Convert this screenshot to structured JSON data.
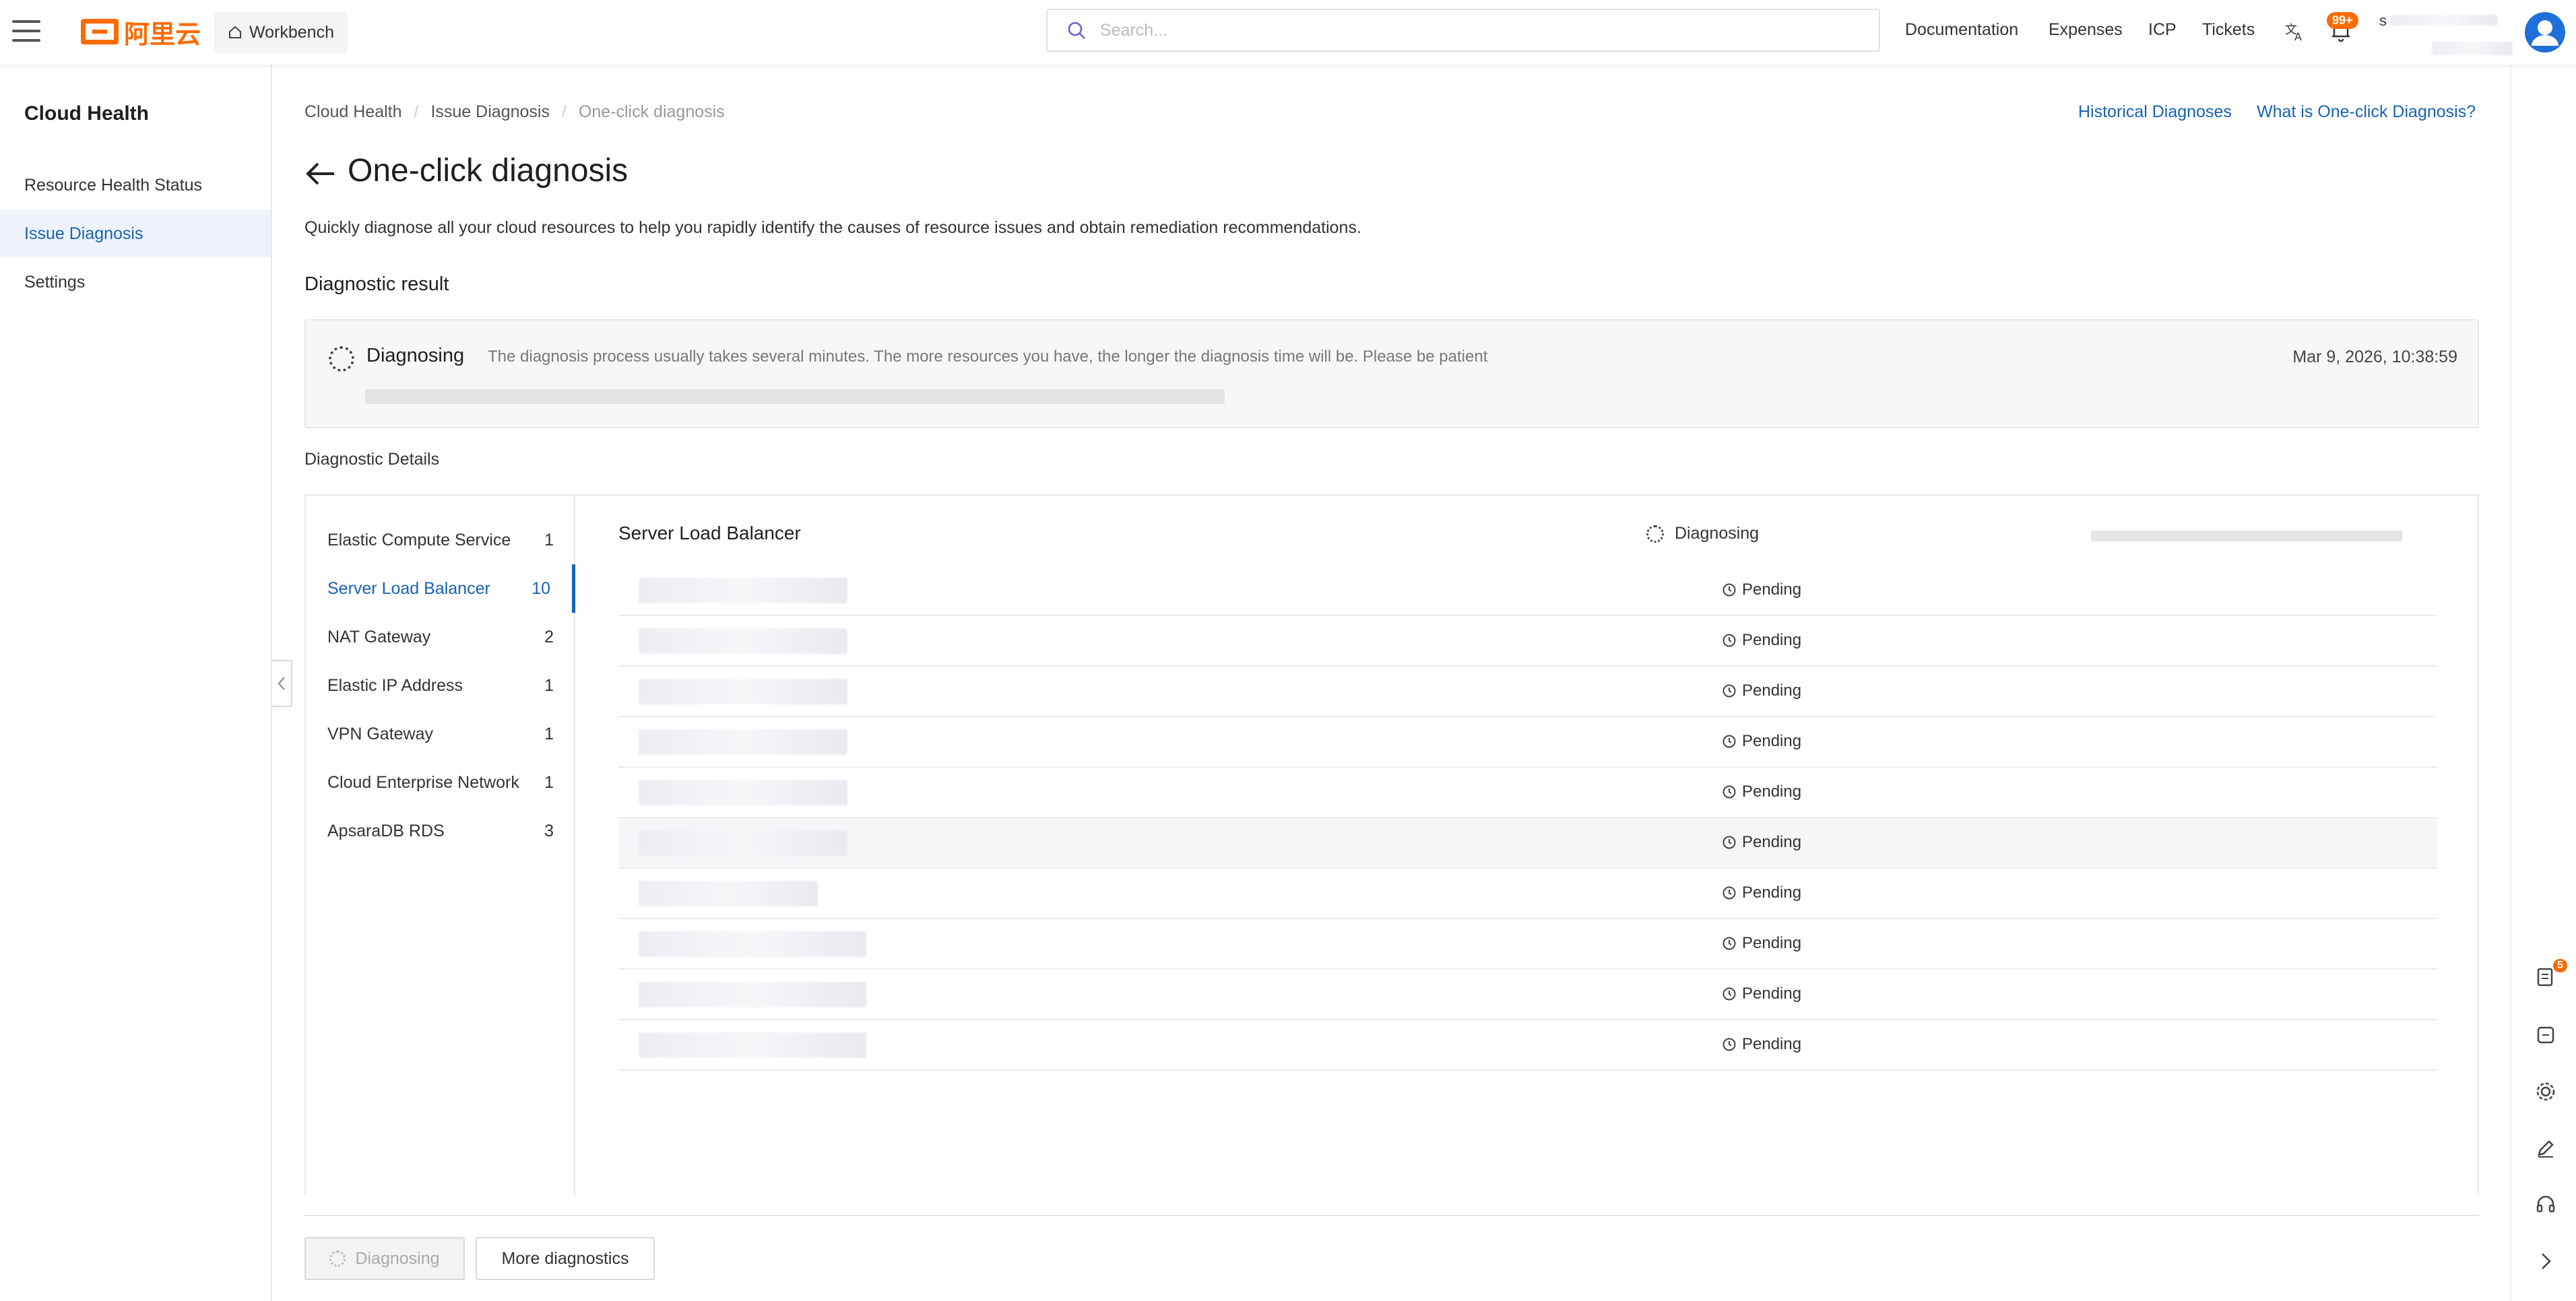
{
  "header": {
    "logo_text": "阿里云",
    "workbench_label": "Workbench",
    "search_placeholder": "Search...",
    "nav": [
      "Documentation",
      "Expenses",
      "ICP",
      "Tickets"
    ],
    "notification_count": "99+",
    "user_initial": "s"
  },
  "sidebar": {
    "title": "Cloud Health",
    "items": [
      {
        "label": "Resource Health Status"
      },
      {
        "label": "Issue Diagnosis"
      },
      {
        "label": "Settings"
      }
    ]
  },
  "breadcrumb": [
    "Cloud Health",
    "Issue Diagnosis",
    "One-click diagnosis"
  ],
  "top_links": {
    "history": "Historical Diagnoses",
    "whatis": "What is One-click Diagnosis?"
  },
  "page": {
    "title": "One-click diagnosis",
    "description": "Quickly diagnose all your cloud resources to help you rapidly identify the causes of resource issues and obtain remediation recommendations."
  },
  "result": {
    "heading": "Diagnostic result",
    "status": "Diagnosing",
    "note": "The diagnosis process usually takes several minutes. The more resources you have, the longer the diagnosis time will be. Please be patient",
    "time": "Mar 9, 2026, 10:38:59"
  },
  "details": {
    "heading": "Diagnostic Details",
    "categories": [
      {
        "name": "Elastic Compute Service",
        "count": "1"
      },
      {
        "name": "Server Load Balancer",
        "count": "10"
      },
      {
        "name": "NAT Gateway",
        "count": "2"
      },
      {
        "name": "Elastic IP Address",
        "count": "1"
      },
      {
        "name": "VPN Gateway",
        "count": "1"
      },
      {
        "name": "Cloud Enterprise Network",
        "count": "1"
      },
      {
        "name": "ApsaraDB RDS",
        "count": "3"
      }
    ],
    "panel_title": "Server Load Balancer",
    "panel_status": "Diagnosing",
    "rows": [
      {
        "status": "Pending"
      },
      {
        "status": "Pending"
      },
      {
        "status": "Pending"
      },
      {
        "status": "Pending"
      },
      {
        "status": "Pending"
      },
      {
        "status": "Pending"
      },
      {
        "status": "Pending"
      },
      {
        "status": "Pending"
      },
      {
        "status": "Pending"
      },
      {
        "status": "Pending"
      }
    ]
  },
  "footer": {
    "diagnosing_label": "Diagnosing",
    "more_label": "More diagnostics"
  },
  "rail": {
    "badge": "5"
  },
  "colors": {
    "brand": "#ff6a00",
    "link": "#1863b4",
    "active_bg": "#eef3fa"
  }
}
